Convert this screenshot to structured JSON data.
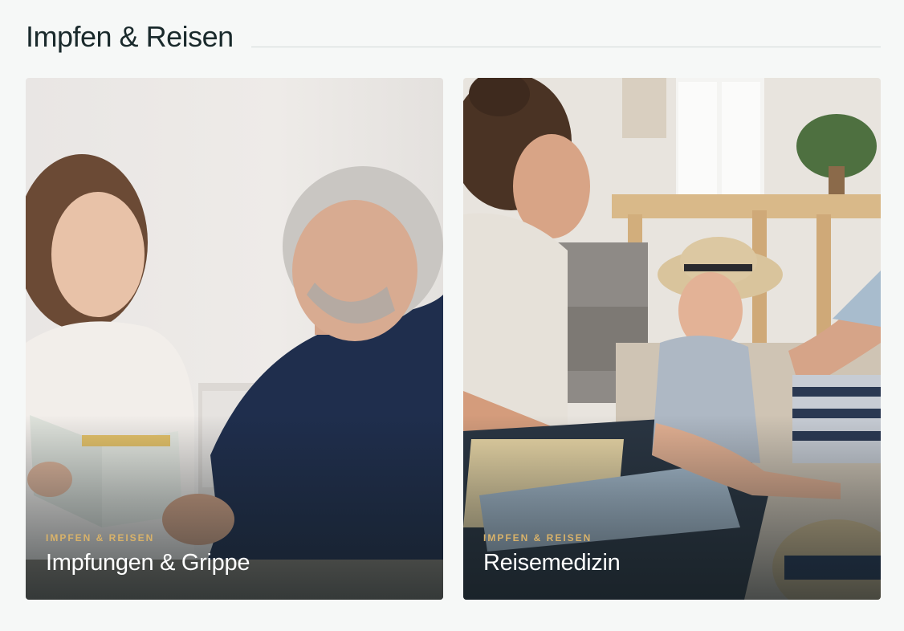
{
  "section": {
    "title": "Impfen & Reisen"
  },
  "cards": [
    {
      "category": "IMPFEN & REISEN",
      "title": "Impfungen & Grippe"
    },
    {
      "category": "IMPFEN & REISEN",
      "title": "Reisemedizin"
    }
  ]
}
